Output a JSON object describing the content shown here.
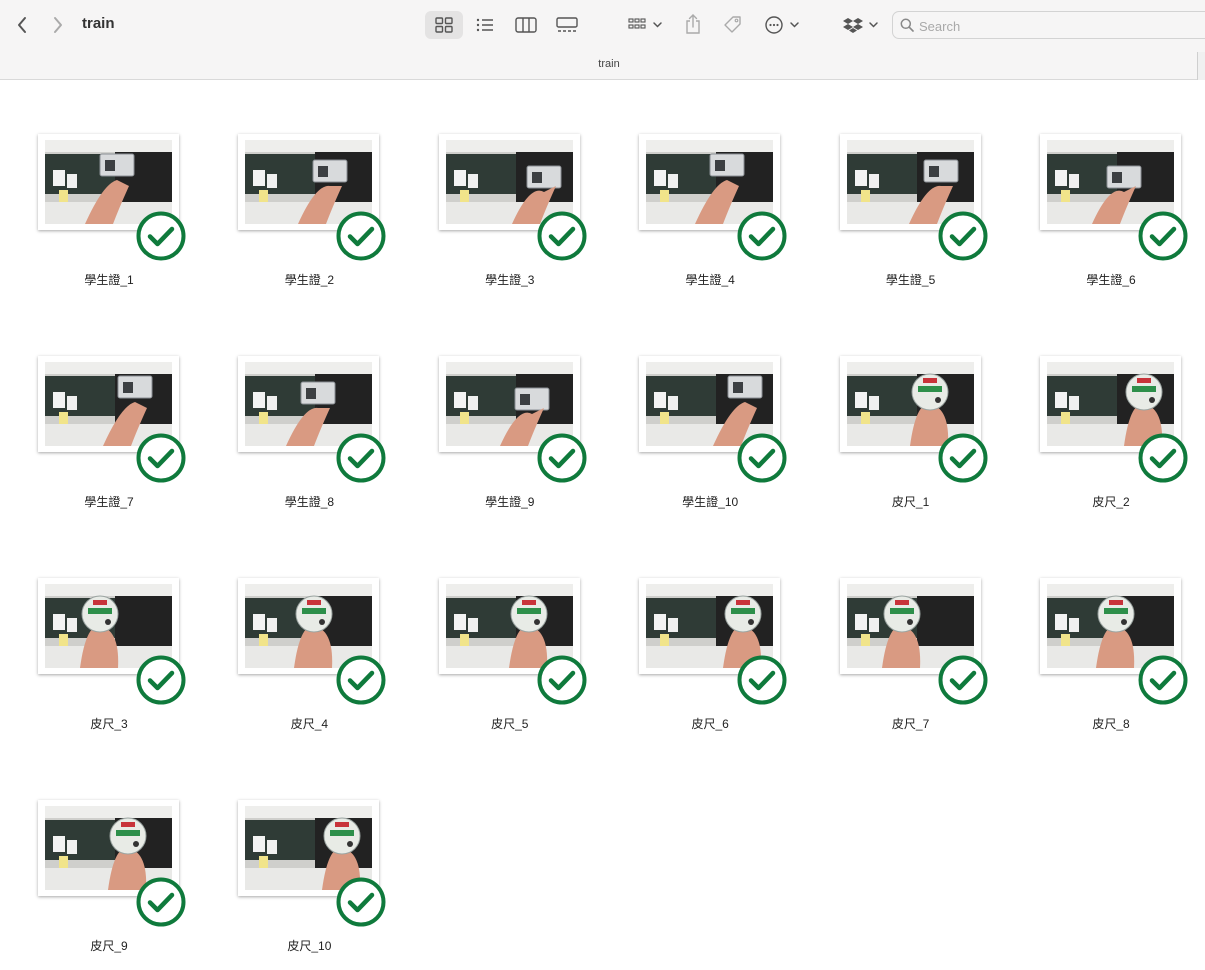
{
  "window": {
    "title": "train",
    "path_label": "train"
  },
  "toolbar": {
    "back_icon": "chevron-left-icon",
    "forward_icon": "chevron-right-icon",
    "view_modes": [
      "icon-view-icon",
      "list-view-icon",
      "column-view-icon",
      "gallery-view-icon"
    ],
    "active_view": "icon-view-icon",
    "group_icon": "group-by-icon",
    "share_icon": "share-icon",
    "tag_icon": "tag-icon",
    "more_icon": "ellipsis-circle-icon",
    "dropbox_icon": "dropbox-icon"
  },
  "search": {
    "placeholder": "Search",
    "value": ""
  },
  "accent": {
    "badge_green": "#0f7a3c",
    "selection_gray": "#e4e3e3"
  },
  "files": [
    {
      "name": "學生證_1",
      "kind": "card",
      "status": "synced"
    },
    {
      "name": "學生證_2",
      "kind": "card",
      "status": "synced"
    },
    {
      "name": "學生證_3",
      "kind": "card",
      "status": "synced"
    },
    {
      "name": "學生證_4",
      "kind": "card",
      "status": "synced"
    },
    {
      "name": "學生證_5",
      "kind": "card",
      "status": "synced"
    },
    {
      "name": "學生證_6",
      "kind": "card",
      "status": "synced"
    },
    {
      "name": "學生證_7",
      "kind": "card",
      "status": "synced"
    },
    {
      "name": "學生證_8",
      "kind": "card",
      "status": "synced"
    },
    {
      "name": "學生證_9",
      "kind": "card",
      "status": "synced"
    },
    {
      "name": "學生證_10",
      "kind": "card",
      "status": "synced"
    },
    {
      "name": "皮尺_1",
      "kind": "tape",
      "status": "synced"
    },
    {
      "name": "皮尺_2",
      "kind": "tape",
      "status": "synced"
    },
    {
      "name": "皮尺_3",
      "kind": "tape",
      "status": "synced"
    },
    {
      "name": "皮尺_4",
      "kind": "tape",
      "status": "synced"
    },
    {
      "name": "皮尺_5",
      "kind": "tape",
      "status": "synced"
    },
    {
      "name": "皮尺_6",
      "kind": "tape",
      "status": "synced"
    },
    {
      "name": "皮尺_7",
      "kind": "tape",
      "status": "synced"
    },
    {
      "name": "皮尺_8",
      "kind": "tape",
      "status": "synced"
    },
    {
      "name": "皮尺_9",
      "kind": "tape",
      "status": "synced"
    },
    {
      "name": "皮尺_10",
      "kind": "tape",
      "status": "synced"
    }
  ]
}
